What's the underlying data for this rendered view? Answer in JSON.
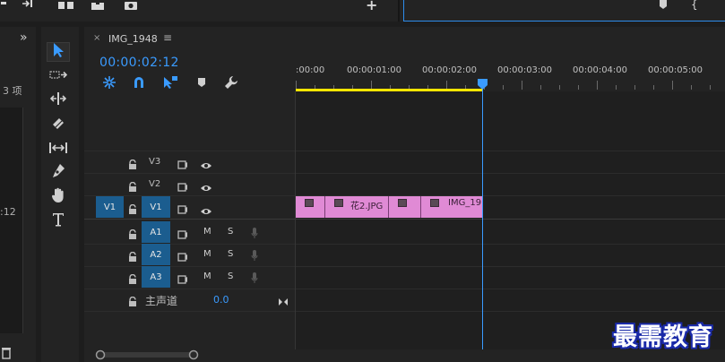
{
  "top_strip": {
    "plus_label": "+"
  },
  "left_panel": {
    "expand_label": "»",
    "item_count": "3 项",
    "time_fragment": ":12"
  },
  "timeline": {
    "tab_close": "×",
    "sequence_name": "IMG_1948",
    "tab_menu": "≡",
    "timecode": "00:00:02:12",
    "ruler_labels": [
      ":00:00",
      "00:00:01:00",
      "00:00:02:00",
      "00:00:03:00",
      "00:00:04:00",
      "00:00:05:00"
    ],
    "playhead_time": "00:00:02:12"
  },
  "video_tracks": [
    {
      "name": "V3",
      "source": ""
    },
    {
      "name": "V2",
      "source": ""
    },
    {
      "name": "V1",
      "source": "V1"
    }
  ],
  "audio_tracks": [
    {
      "name": "A1",
      "mute": "M",
      "solo": "S"
    },
    {
      "name": "A2",
      "mute": "M",
      "solo": "S"
    },
    {
      "name": "A3",
      "mute": "M",
      "solo": "S"
    }
  ],
  "master_track": {
    "label": "主声道",
    "level": "0.0"
  },
  "clips": [
    {
      "label": ""
    },
    {
      "label": "花2.JPG"
    },
    {
      "label": ""
    },
    {
      "label": "IMG_19"
    }
  ],
  "colors": {
    "accent_blue": "#3a9bff",
    "track_selected": "#1b5d8f",
    "clip_pink": "#e08ad5",
    "work_area_yellow": "#ffe600"
  },
  "watermark": {
    "text": "最需教育"
  }
}
